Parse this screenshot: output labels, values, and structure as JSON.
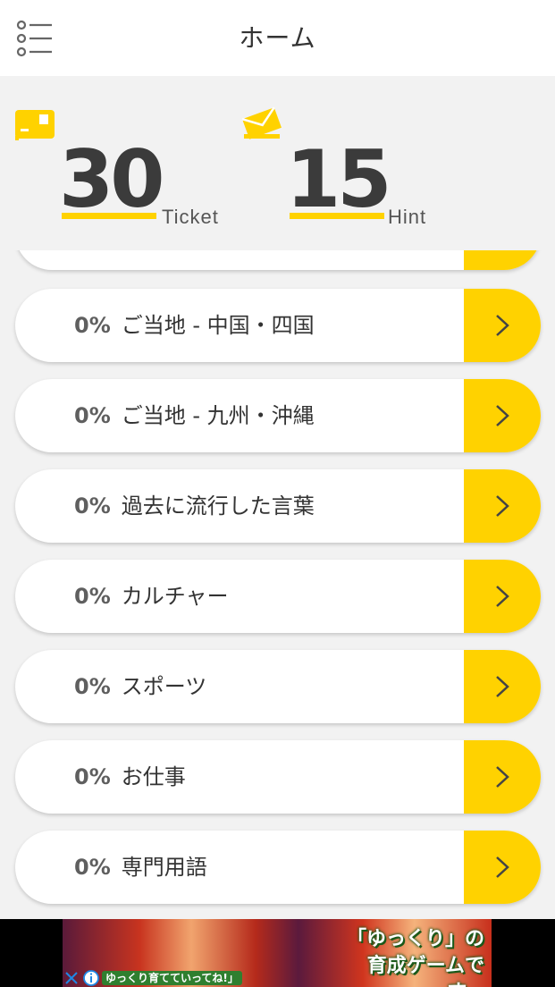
{
  "header": {
    "title": "ホーム",
    "menu_icon": "list-menu-icon"
  },
  "stats": {
    "ticket": {
      "value": "30",
      "label": "Ticket",
      "icon": "ticket-card-icon"
    },
    "hint": {
      "value": "15",
      "label": "Hint",
      "icon": "envelope-icon"
    }
  },
  "categories": [
    {
      "percent": "0%",
      "name": "ご当地 - 中国・四国"
    },
    {
      "percent": "0%",
      "name": "ご当地 - 九州・沖縄"
    },
    {
      "percent": "0%",
      "name": "過去に流行した言葉"
    },
    {
      "percent": "0%",
      "name": "カルチャー"
    },
    {
      "percent": "0%",
      "name": "スポーツ"
    },
    {
      "percent": "0%",
      "name": "お仕事"
    },
    {
      "percent": "0%",
      "name": "専門用語"
    }
  ],
  "ad": {
    "headline_line1": "「ゆっくり」の",
    "headline_line2": "育成ゲームです。",
    "subtext": "ゆっくり育てていってね!」"
  },
  "colors": {
    "accent": "#ffd200",
    "background": "#f2f2f2",
    "header_bg": "#ffffff",
    "text": "#333333"
  }
}
